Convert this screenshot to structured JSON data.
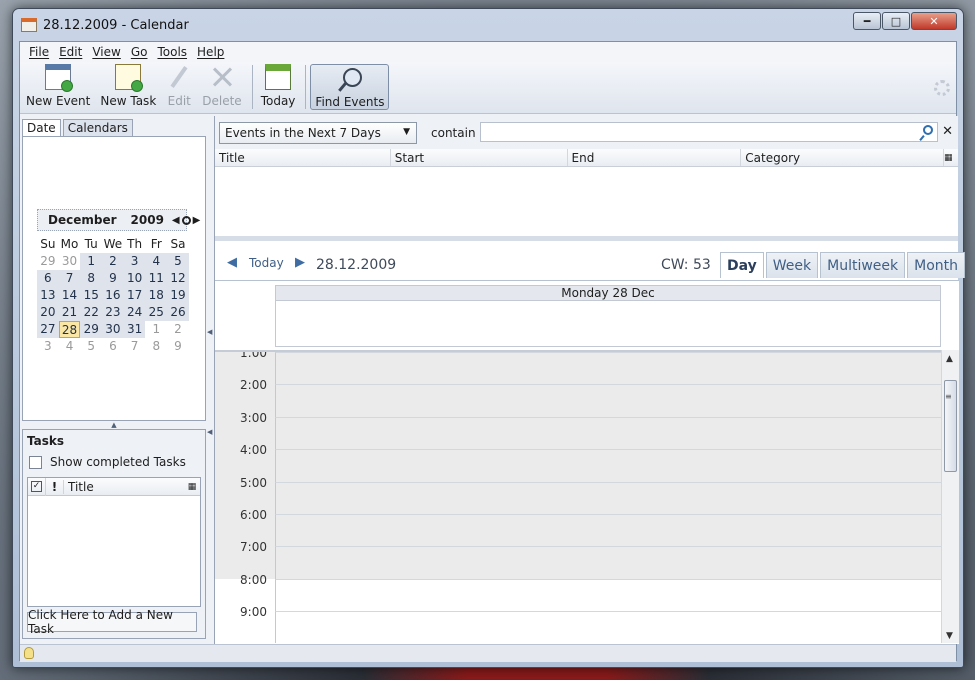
{
  "window": {
    "title": "28.12.2009 - Calendar"
  },
  "menu": [
    "File",
    "Edit",
    "View",
    "Go",
    "Tools",
    "Help"
  ],
  "toolbar": {
    "new_event": "New Event",
    "new_task": "New Task",
    "edit": "Edit",
    "delete": "Delete",
    "today": "Today",
    "find_events": "Find Events"
  },
  "left": {
    "tabs": [
      "Date",
      "Calendars"
    ],
    "minical": {
      "month": "December",
      "year": "2009",
      "weekdays": [
        "Su",
        "Mo",
        "Tu",
        "We",
        "Th",
        "Fr",
        "Sa"
      ],
      "weeks": [
        [
          "29",
          "30",
          "1",
          "2",
          "3",
          "4",
          "5"
        ],
        [
          "6",
          "7",
          "8",
          "9",
          "10",
          "11",
          "12"
        ],
        [
          "13",
          "14",
          "15",
          "16",
          "17",
          "18",
          "19"
        ],
        [
          "20",
          "21",
          "22",
          "23",
          "24",
          "25",
          "26"
        ],
        [
          "27",
          "28",
          "29",
          "30",
          "31",
          "1",
          "2"
        ],
        [
          "3",
          "4",
          "5",
          "6",
          "7",
          "8",
          "9"
        ]
      ],
      "today": "28"
    },
    "tasks": {
      "title": "Tasks",
      "show_completed": "Show completed Tasks",
      "col_priority": "!",
      "col_title": "Title",
      "add_task": "Click Here to Add a New Task"
    }
  },
  "right": {
    "filter": "Events in the Next 7 Days",
    "contain": "contain",
    "search_value": "",
    "columns": [
      "Title",
      "Start",
      "End",
      "Category"
    ],
    "nav": {
      "today": "Today",
      "date": "28.12.2009",
      "cw": "CW: 53"
    },
    "view_tabs": [
      "Day",
      "Week",
      "Multiweek",
      "Month"
    ],
    "selected_view": "Day",
    "day_header": "Monday 28 Dec",
    "hours": [
      "1:00",
      "2:00",
      "3:00",
      "4:00",
      "5:00",
      "6:00",
      "7:00",
      "8:00",
      "9:00"
    ],
    "work_starts_at": "8:00"
  }
}
